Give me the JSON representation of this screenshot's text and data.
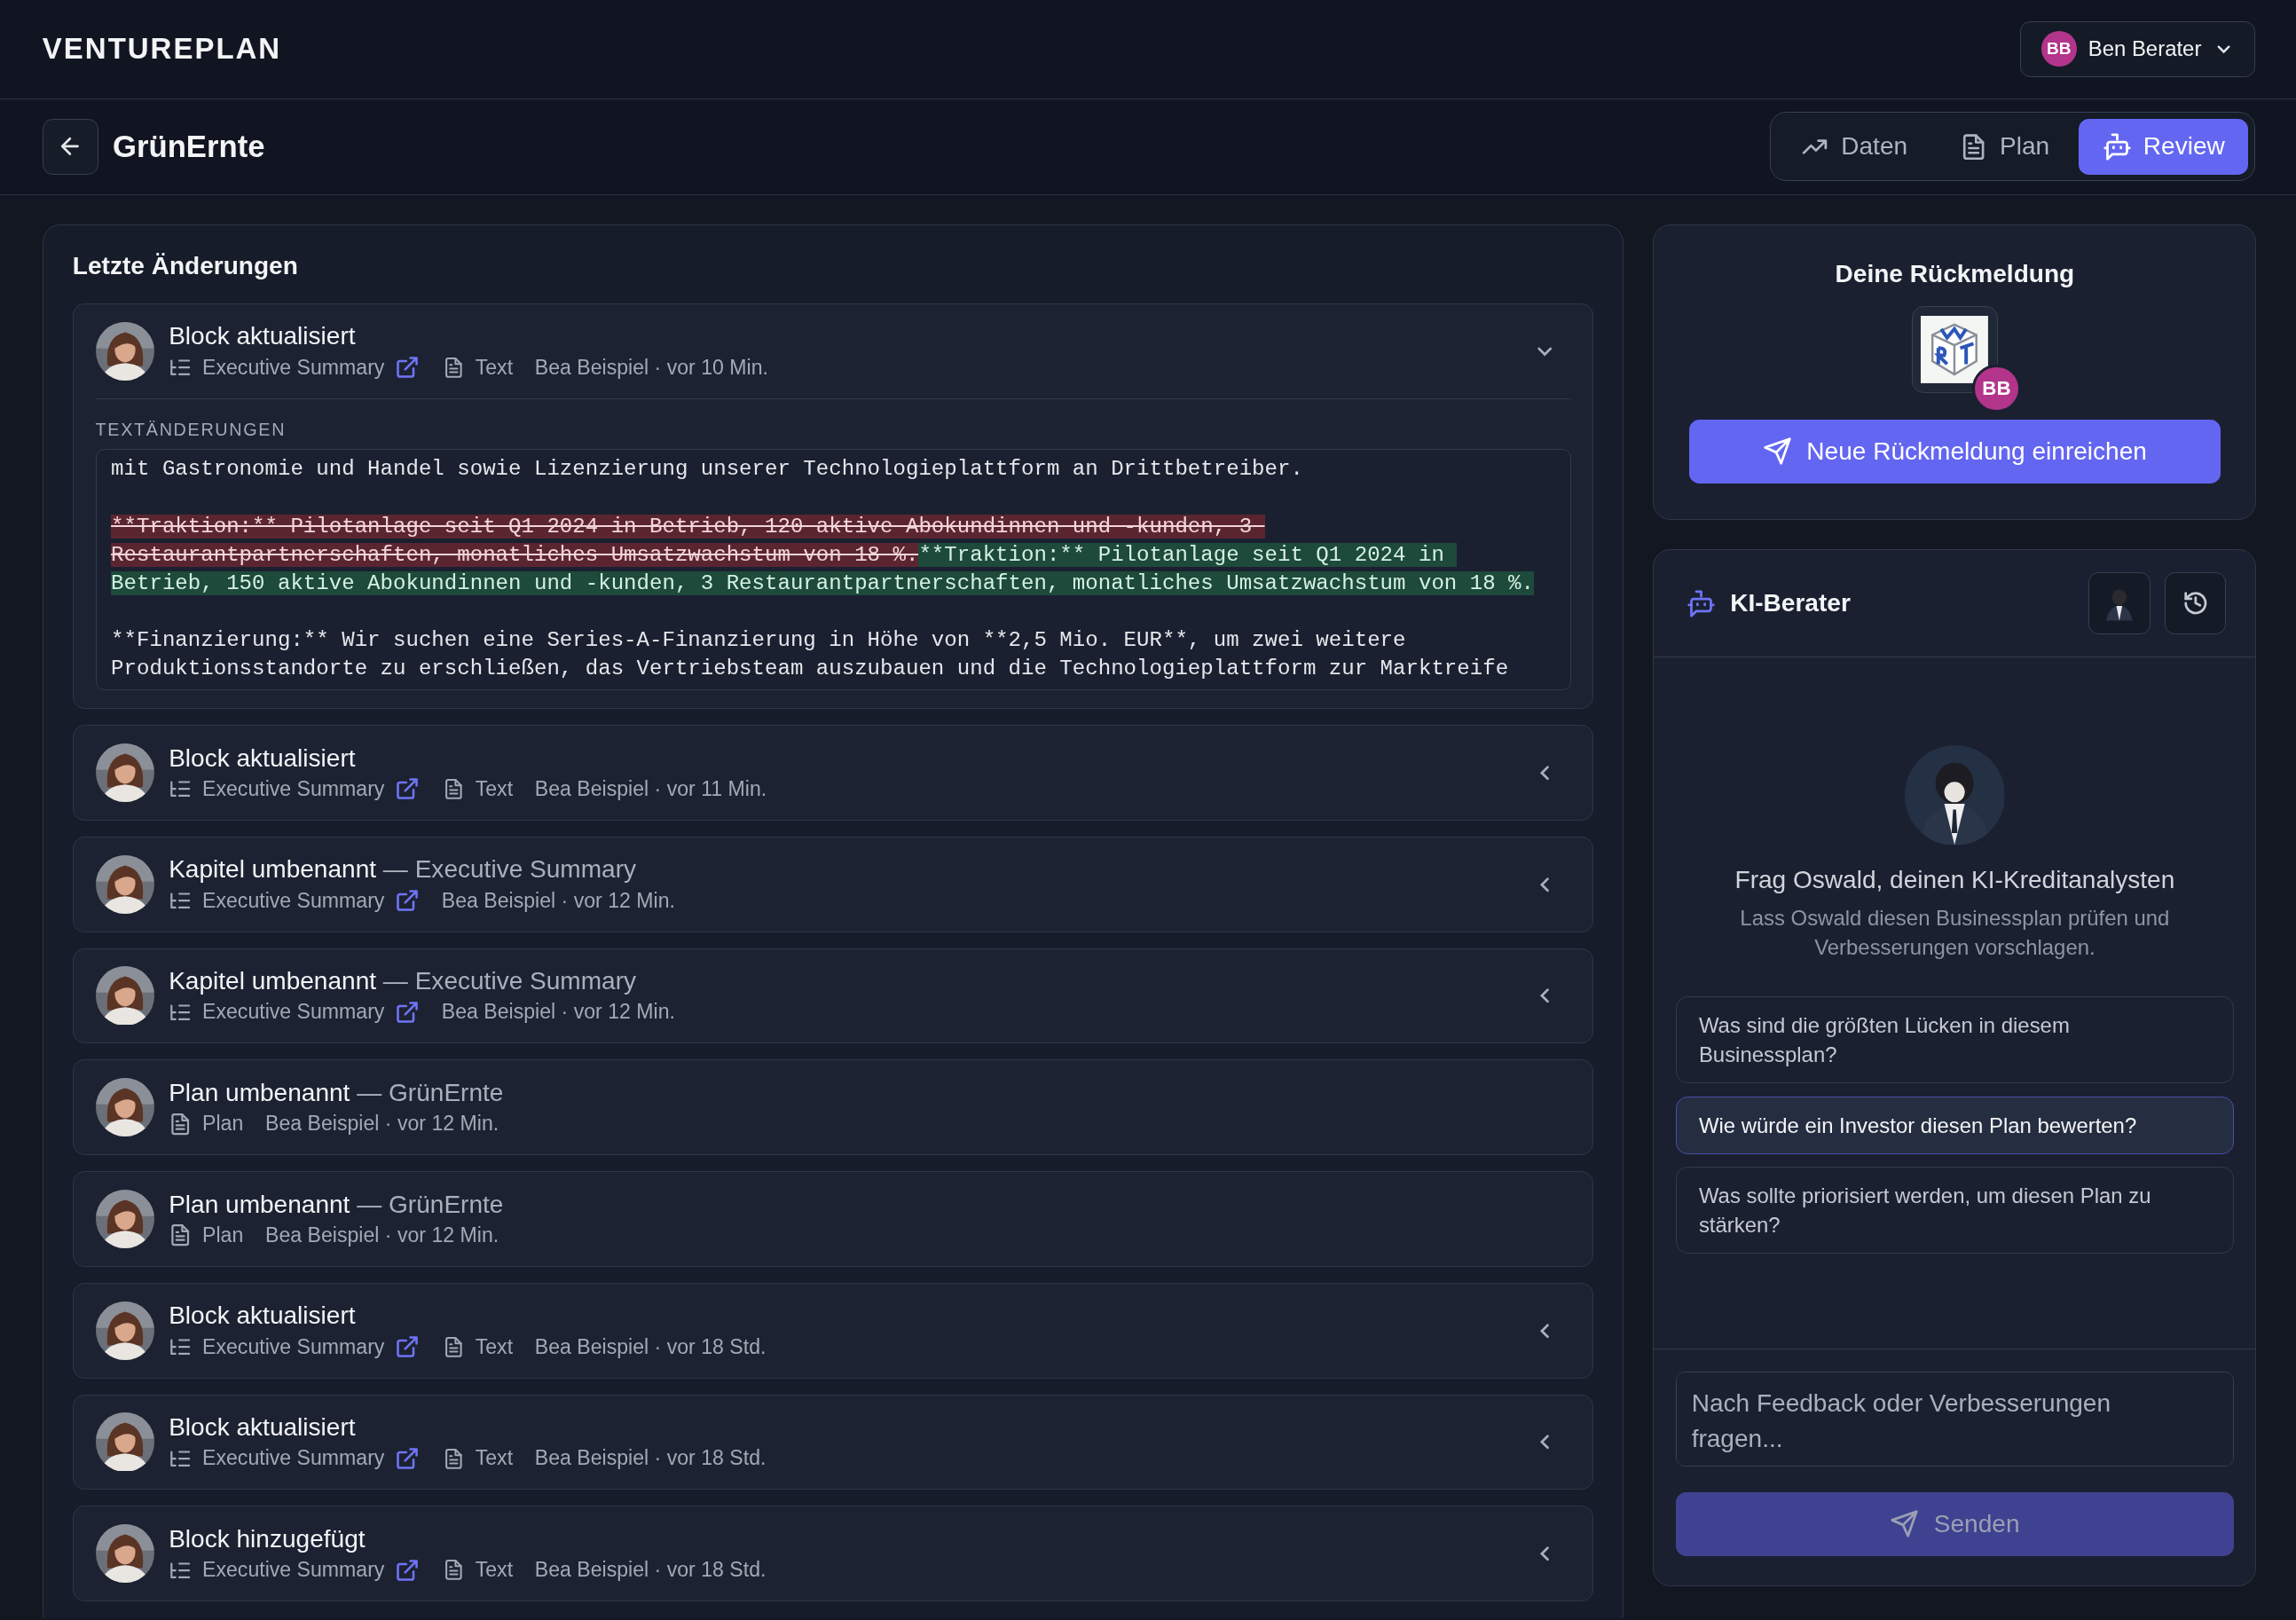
{
  "app": {
    "logo": "VENTUREPLAN",
    "user": {
      "initials": "BB",
      "name": "Ben Berater"
    }
  },
  "plan": {
    "title": "GrünErnte"
  },
  "tabs": [
    {
      "label": "Daten",
      "kind": "data",
      "selected": false
    },
    {
      "label": "Plan",
      "kind": "plan",
      "selected": false
    },
    {
      "label": "Review",
      "kind": "review",
      "selected": true
    }
  ],
  "changes": {
    "title": "Letzte Änderungen",
    "items": [
      {
        "title": "Block aktualisiert",
        "kind": "chapter",
        "chapter": "Executive Summary",
        "block_type": "Text",
        "byline": "Bea Beispiel · vor 10 Min.",
        "expanded": true,
        "diff": {
          "label": "TEXTÄNDERUNGEN",
          "segments": [
            {
              "kind": "context",
              "text": "mit Gastronomie und Handel sowie Lizenzierung unserer Technologieplattform an Drittbetreiber.\n\n"
            },
            {
              "kind": "removed",
              "text": "**Traktion:** Pilotanlage seit Q1 2024 in Betrieb, 120 aktive Abokundinnen und -kunden, 3 Restaurantpartnerschaften, monatliches Umsatzwachstum von 18 %."
            },
            {
              "kind": "added",
              "text": "**Traktion:** Pilotanlage seit Q1 2024 in Betrieb, 150 aktive Abokundinnen und -kunden, 3 Restaurantpartnerschaften, monatliches Umsatzwachstum von 18 %."
            },
            {
              "kind": "context",
              "text": "\n\n**Finanzierung:** Wir suchen eine Series-A-Finanzierung in Höhe von **2,5 Mio. EUR**, um zwei weitere Produktionsstandorte zu erschließen, das Vertriebsteam auszubauen und die Technologieplattform zur Marktreife"
            }
          ]
        }
      },
      {
        "title": "Block aktualisiert",
        "kind": "chapter",
        "chapter": "Executive Summary",
        "block_type": "Text",
        "byline": "Bea Beispiel · vor 11 Min.",
        "expanded": false
      },
      {
        "title": "Kapitel umbenannt",
        "target": "— Executive Summary",
        "kind": "chapter",
        "chapter": "Executive Summary",
        "byline": "Bea Beispiel · vor 12 Min.",
        "expanded": false
      },
      {
        "title": "Kapitel umbenannt",
        "target": "— Executive Summary",
        "kind": "chapter",
        "chapter": "Executive Summary",
        "byline": "Bea Beispiel · vor 12 Min.",
        "expanded": false
      },
      {
        "title": "Plan umbenannt",
        "target": "— GrünErnte",
        "kind": "plan",
        "chapter": "Plan",
        "byline": "Bea Beispiel · vor 12 Min."
      },
      {
        "title": "Plan umbenannt",
        "target": "— GrünErnte",
        "kind": "plan",
        "chapter": "Plan",
        "byline": "Bea Beispiel · vor 12 Min."
      },
      {
        "title": "Block aktualisiert",
        "kind": "chapter",
        "chapter": "Executive Summary",
        "block_type": "Text",
        "byline": "Bea Beispiel · vor 18 Std.",
        "expanded": false
      },
      {
        "title": "Block aktualisiert",
        "kind": "chapter",
        "chapter": "Executive Summary",
        "block_type": "Text",
        "byline": "Bea Beispiel · vor 18 Std.",
        "expanded": false
      },
      {
        "title": "Block hinzugefügt",
        "kind": "chapter",
        "chapter": "Executive Summary",
        "block_type": "Text",
        "byline": "Bea Beispiel · vor 18 Std.",
        "expanded": false
      }
    ]
  },
  "feedback": {
    "title": "Deine Rückmeldung",
    "badge": "BB",
    "button": "Neue Rückmeldung einreichen"
  },
  "advisor": {
    "title": "KI-Berater",
    "heading": "Frag Oswald, deinen KI-Kreditanalysten",
    "description": "Lass Oswald diesen Businessplan prüfen und Verbesserungen vorschlagen.",
    "suggestions": [
      {
        "text": "Was sind die größten Lücken in diesem Businessplan?",
        "selected": false
      },
      {
        "text": "Wie würde ein Investor diesen Plan bewerten?",
        "selected": true
      },
      {
        "text": "Was sollte priorisiert werden, um diesen Plan zu stärken?",
        "selected": false
      }
    ],
    "input": {
      "placeholder": "Nach Feedback oder Verbesserungen fragen..."
    },
    "send": {
      "label": "Senden",
      "disabled": true
    }
  }
}
